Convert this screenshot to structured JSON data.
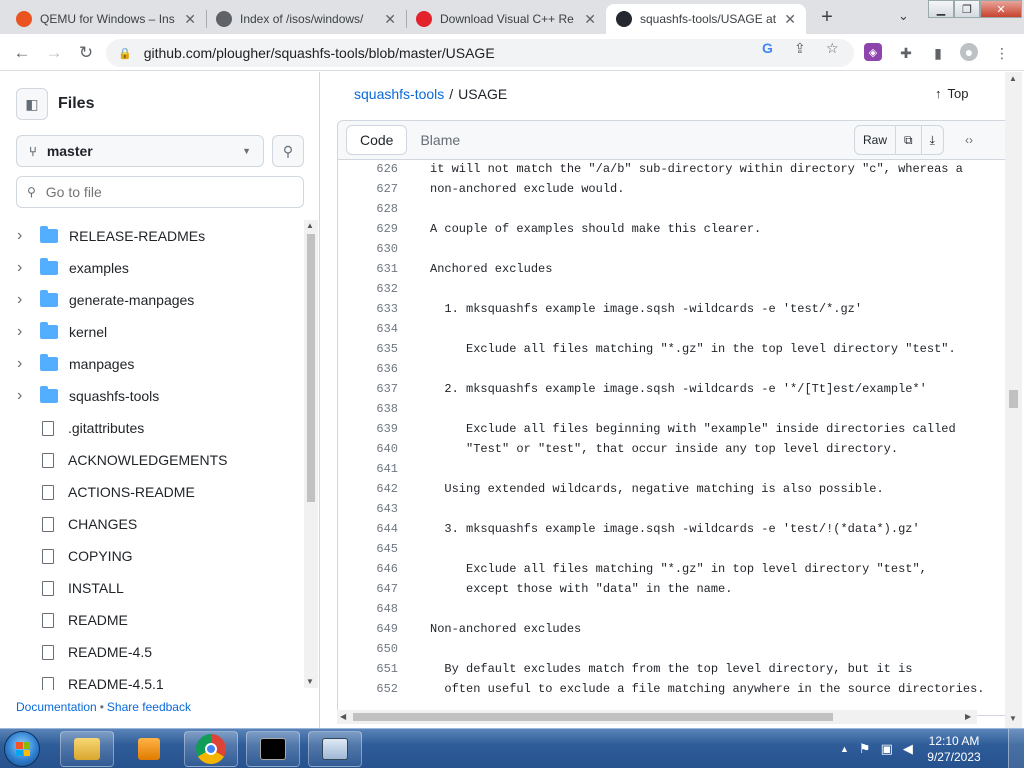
{
  "browser": {
    "tabs": [
      {
        "title": "QEMU for Windows – Ins",
        "favicon": "qemu-icon",
        "color": "#e95420",
        "active": false
      },
      {
        "title": "Index of /isos/windows/",
        "favicon": "globe-icon",
        "color": "#5f6368",
        "active": false
      },
      {
        "title": "Download Visual C++ Re",
        "favicon": "opera-icon",
        "color": "#e3232c",
        "active": false
      },
      {
        "title": "squashfs-tools/USAGE at",
        "favicon": "github-icon",
        "color": "#24292f",
        "active": true
      }
    ],
    "url": "github.com/plougher/squashfs-tools/blob/master/USAGE"
  },
  "sidebar": {
    "title": "Files",
    "branch": "master",
    "goto_placeholder": "Go to file",
    "items": [
      {
        "name": "RELEASE-READMEs",
        "type": "dir"
      },
      {
        "name": "examples",
        "type": "dir"
      },
      {
        "name": "generate-manpages",
        "type": "dir"
      },
      {
        "name": "kernel",
        "type": "dir"
      },
      {
        "name": "manpages",
        "type": "dir"
      },
      {
        "name": "squashfs-tools",
        "type": "dir"
      },
      {
        "name": ".gitattributes",
        "type": "file"
      },
      {
        "name": "ACKNOWLEDGEMENTS",
        "type": "file"
      },
      {
        "name": "ACTIONS-README",
        "type": "file"
      },
      {
        "name": "CHANGES",
        "type": "file"
      },
      {
        "name": "COPYING",
        "type": "file"
      },
      {
        "name": "INSTALL",
        "type": "file"
      },
      {
        "name": "README",
        "type": "file"
      },
      {
        "name": "README-4.5",
        "type": "file"
      },
      {
        "name": "README-4.5.1",
        "type": "file"
      }
    ],
    "footer": {
      "documentation": "Documentation",
      "separator": "•",
      "feedback": "Share feedback"
    }
  },
  "main": {
    "breadcrumb": {
      "repo": "squashfs-tools",
      "separator": "/",
      "file": "USAGE"
    },
    "top_link": "Top",
    "tabs": {
      "code": "Code",
      "blame": "Blame"
    },
    "raw_label": "Raw",
    "code_lines": [
      {
        "n": "626",
        "t": "it will not match the \"/a/b\" sub-directory within directory \"c\", whereas a"
      },
      {
        "n": "627",
        "t": "non-anchored exclude would."
      },
      {
        "n": "628",
        "t": ""
      },
      {
        "n": "629",
        "t": "A couple of examples should make this clearer."
      },
      {
        "n": "630",
        "t": ""
      },
      {
        "n": "631",
        "t": "Anchored excludes"
      },
      {
        "n": "632",
        "t": ""
      },
      {
        "n": "633",
        "t": "  1. mksquashfs example image.sqsh -wildcards -e 'test/*.gz'"
      },
      {
        "n": "634",
        "t": ""
      },
      {
        "n": "635",
        "t": "     Exclude all files matching \"*.gz\" in the top level directory \"test\"."
      },
      {
        "n": "636",
        "t": ""
      },
      {
        "n": "637",
        "t": "  2. mksquashfs example image.sqsh -wildcards -e '*/[Tt]est/example*'"
      },
      {
        "n": "638",
        "t": ""
      },
      {
        "n": "639",
        "t": "     Exclude all files beginning with \"example\" inside directories called"
      },
      {
        "n": "640",
        "t": "     \"Test\" or \"test\", that occur inside any top level directory."
      },
      {
        "n": "641",
        "t": ""
      },
      {
        "n": "642",
        "t": "  Using extended wildcards, negative matching is also possible."
      },
      {
        "n": "643",
        "t": ""
      },
      {
        "n": "644",
        "t": "  3. mksquashfs example image.sqsh -wildcards -e 'test/!(*data*).gz'"
      },
      {
        "n": "645",
        "t": ""
      },
      {
        "n": "646",
        "t": "     Exclude all files matching \"*.gz\" in top level directory \"test\","
      },
      {
        "n": "647",
        "t": "     except those with \"data\" in the name."
      },
      {
        "n": "648",
        "t": ""
      },
      {
        "n": "649",
        "t": "Non-anchored excludes"
      },
      {
        "n": "650",
        "t": ""
      },
      {
        "n": "651",
        "t": "  By default excludes match from the top level directory, but it is"
      },
      {
        "n": "652",
        "t": "  often useful to exclude a file matching anywhere in the source directories."
      }
    ]
  },
  "taskbar": {
    "clock_time": "12:10 AM",
    "clock_date": "9/27/2023"
  },
  "colors": {
    "link": "#0969da",
    "folder": "#54aeff"
  }
}
